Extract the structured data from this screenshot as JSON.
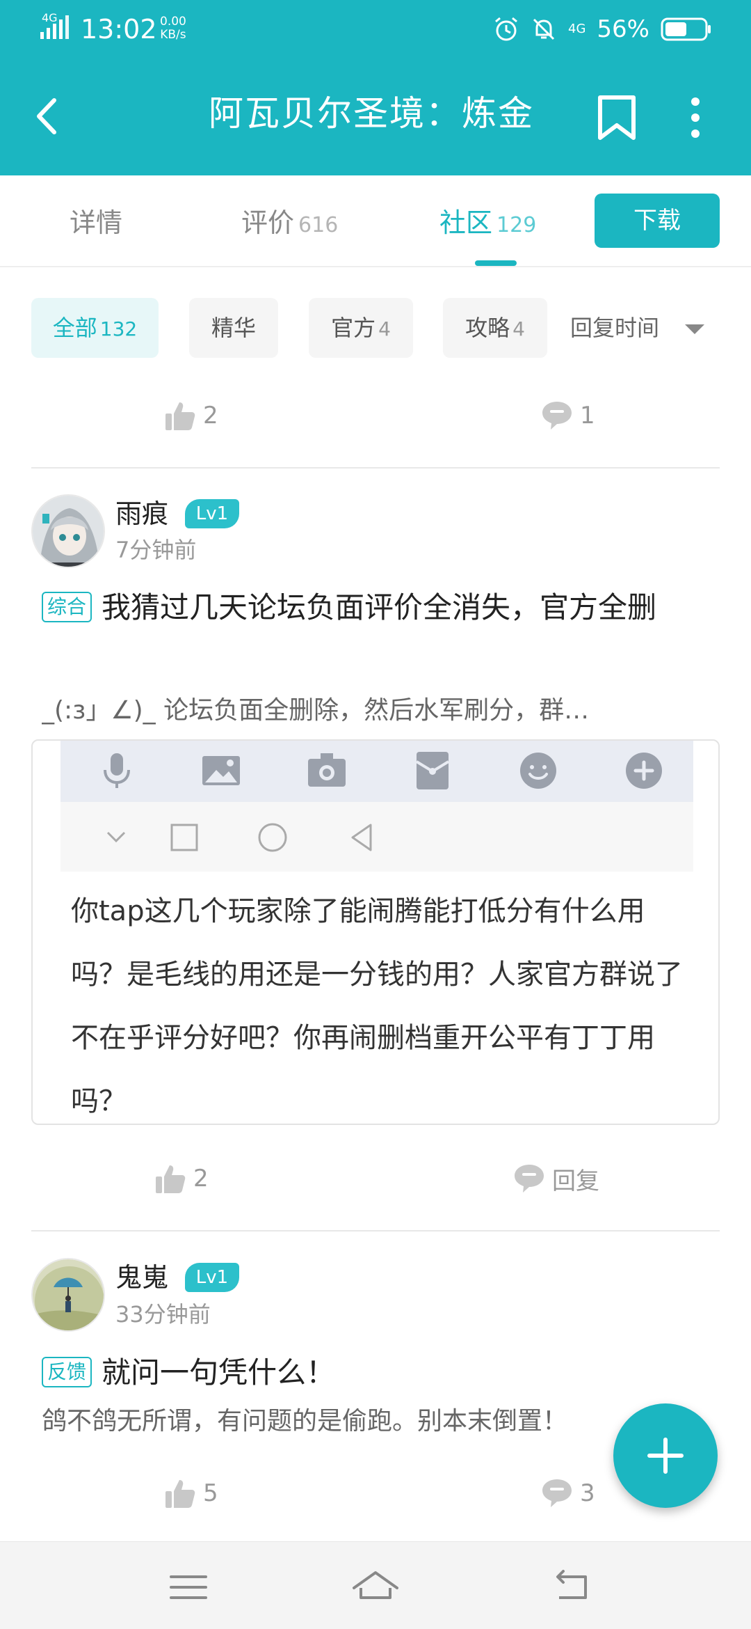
{
  "status_bar": {
    "network": "4G",
    "time": "13:02",
    "speed_value": "0.00",
    "speed_unit": "KB/s",
    "network_right": "4G",
    "battery": "56%",
    "battery_level": 0.56
  },
  "app_bar": {
    "title": "阿瓦贝尔圣境：炼金"
  },
  "tabs": [
    {
      "label": "详情",
      "count": ""
    },
    {
      "label": "评价",
      "count": "616"
    },
    {
      "label": "社区",
      "count": "129"
    }
  ],
  "download_label": "下载",
  "filters": [
    {
      "label": "全部",
      "count": "132"
    },
    {
      "label": "精华",
      "count": ""
    },
    {
      "label": "官方",
      "count": "4"
    },
    {
      "label": "攻略",
      "count": "4"
    }
  ],
  "sort_label": "回复时间",
  "prev_post": {
    "likes": "2",
    "comments": "1"
  },
  "posts": [
    {
      "username": "雨痕",
      "level": "Lv1",
      "time": "7分钟前",
      "tag": "综合",
      "title": "我猜过几天论坛负面评价全消失，官方全删",
      "excerpt": "_(:з」∠)_ 论坛负面全删除，然后水军刷分，群…",
      "image_text": "你tap这几个玩家除了能闹腾能打低分有什么用吗？是毛线的用还是一分钱的用？人家官方群说了不在乎评分好吧？你再闹删档重开公平有丁丁用吗？",
      "likes": "2",
      "reply_label": "回复"
    },
    {
      "username": "鬼嵬",
      "level": "Lv1",
      "time": "33分钟前",
      "tag": "反馈",
      "title": "就问一句凭什么！",
      "excerpt": "鸽不鸽无所谓，有问题的是偷跑。别本末倒置！",
      "likes": "5",
      "comments": "3"
    }
  ],
  "colors": {
    "accent": "#1bb6c1",
    "accent_light": "#e7f7f8"
  },
  "icons": {
    "like": "thumbs-up-icon",
    "comment": "comment-bubble-icon",
    "fab": "plus-icon"
  }
}
